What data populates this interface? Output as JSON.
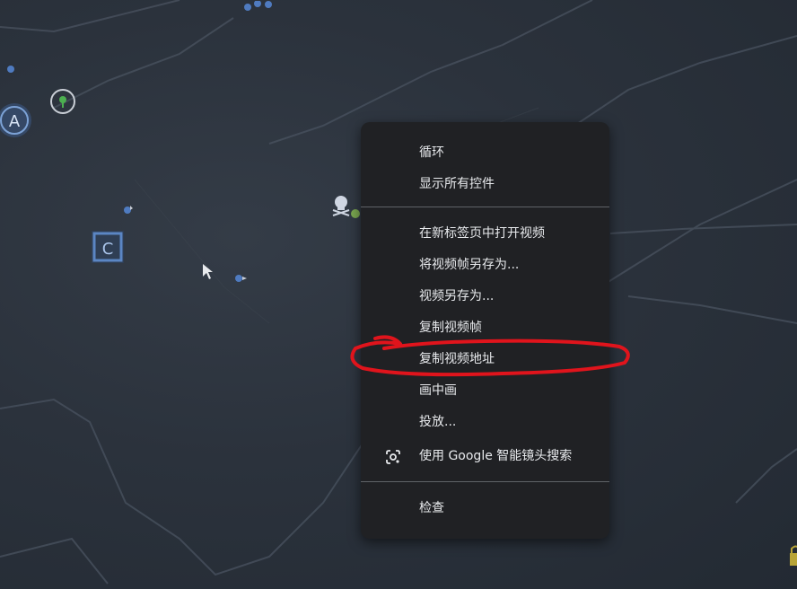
{
  "context_menu": {
    "items": [
      {
        "label": "循环"
      },
      {
        "label": "显示所有控件"
      },
      {
        "label": "在新标签页中打开视频"
      },
      {
        "label": "将视频帧另存为..."
      },
      {
        "label": "视频另存为..."
      },
      {
        "label": "复制视频帧"
      },
      {
        "label": "复制视频地址"
      },
      {
        "label": "画中画"
      },
      {
        "label": "投放..."
      },
      {
        "label": "使用 Google 智能镜头搜索",
        "icon": "google-lens-icon"
      },
      {
        "label": "检查"
      }
    ]
  },
  "map_markers": {
    "zone_a_label": "A",
    "zone_c_label": "C"
  },
  "annotation": {
    "color": "#e0141c",
    "target": "复制视频地址"
  },
  "colors": {
    "menu_bg": "#202124",
    "menu_text": "#e8eaed",
    "separator": "#5f6368",
    "map_bg": "#2a313b",
    "marker_blue": "#4f7bc0"
  }
}
